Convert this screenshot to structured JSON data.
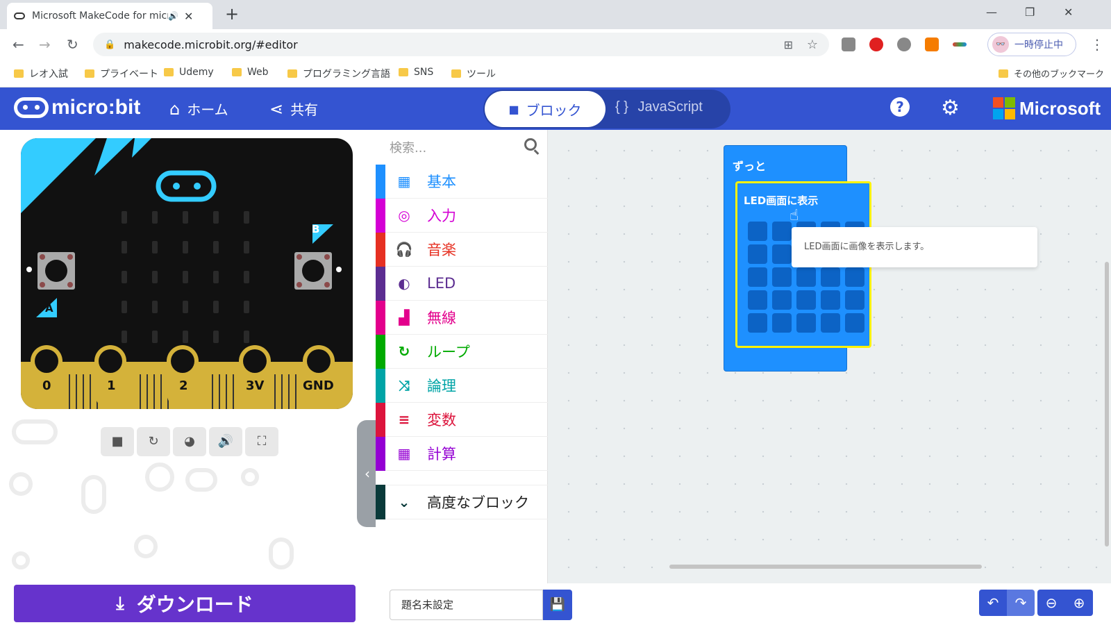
{
  "browser": {
    "tab_title": "Microsoft MakeCode for micro:bit",
    "url": "makecode.microbit.org/#editor",
    "profile_label": "一時停止中",
    "bookmarks": [
      "レオ入試",
      "プライベート",
      "Udemy",
      "Web",
      "プログラミング言語",
      "SNS",
      "ツール"
    ],
    "other_bookmarks": "その他のブックマーク"
  },
  "header": {
    "logo": "micro:bit",
    "home": "ホーム",
    "share": "共有",
    "blocks_tab": "ブロック",
    "js_tab": "JavaScript",
    "help": "?",
    "brand": "Microsoft"
  },
  "simulator": {
    "pins": [
      "0",
      "1",
      "2",
      "3V",
      "GND"
    ],
    "button_a": "A",
    "button_b": "B"
  },
  "toolbox": {
    "search_placeholder": "検索...",
    "categories": [
      {
        "label": "基本",
        "color": "#1e90ff",
        "icon": "grid-icon"
      },
      {
        "label": "入力",
        "color": "#d400d4",
        "icon": "target-icon"
      },
      {
        "label": "音楽",
        "color": "#e63022",
        "icon": "headphones-icon"
      },
      {
        "label": "LED",
        "color": "#5c2d91",
        "icon": "toggle-icon"
      },
      {
        "label": "無線",
        "color": "#e3008c",
        "icon": "signal-icon"
      },
      {
        "label": "ループ",
        "color": "#00aa00",
        "icon": "loop-icon"
      },
      {
        "label": "論理",
        "color": "#00a4a6",
        "icon": "shuffle-icon"
      },
      {
        "label": "変数",
        "color": "#dc143c",
        "icon": "list-icon"
      },
      {
        "label": "計算",
        "color": "#9400d3",
        "icon": "calculator-icon"
      }
    ],
    "advanced": {
      "label": "高度なブロック",
      "color": "#0a3a3a"
    }
  },
  "workspace": {
    "forever_label": "ずっと",
    "show_leds_label": "LED画面に表示",
    "tooltip": "LED画面に画像を表示します。"
  },
  "bottom": {
    "download_label": "ダウンロード",
    "project_placeholder": "題名未設定"
  },
  "colors": {
    "header": "#3454d1",
    "download": "#6633cc",
    "block": "#1e90ff",
    "block_highlight": "#fff200"
  }
}
